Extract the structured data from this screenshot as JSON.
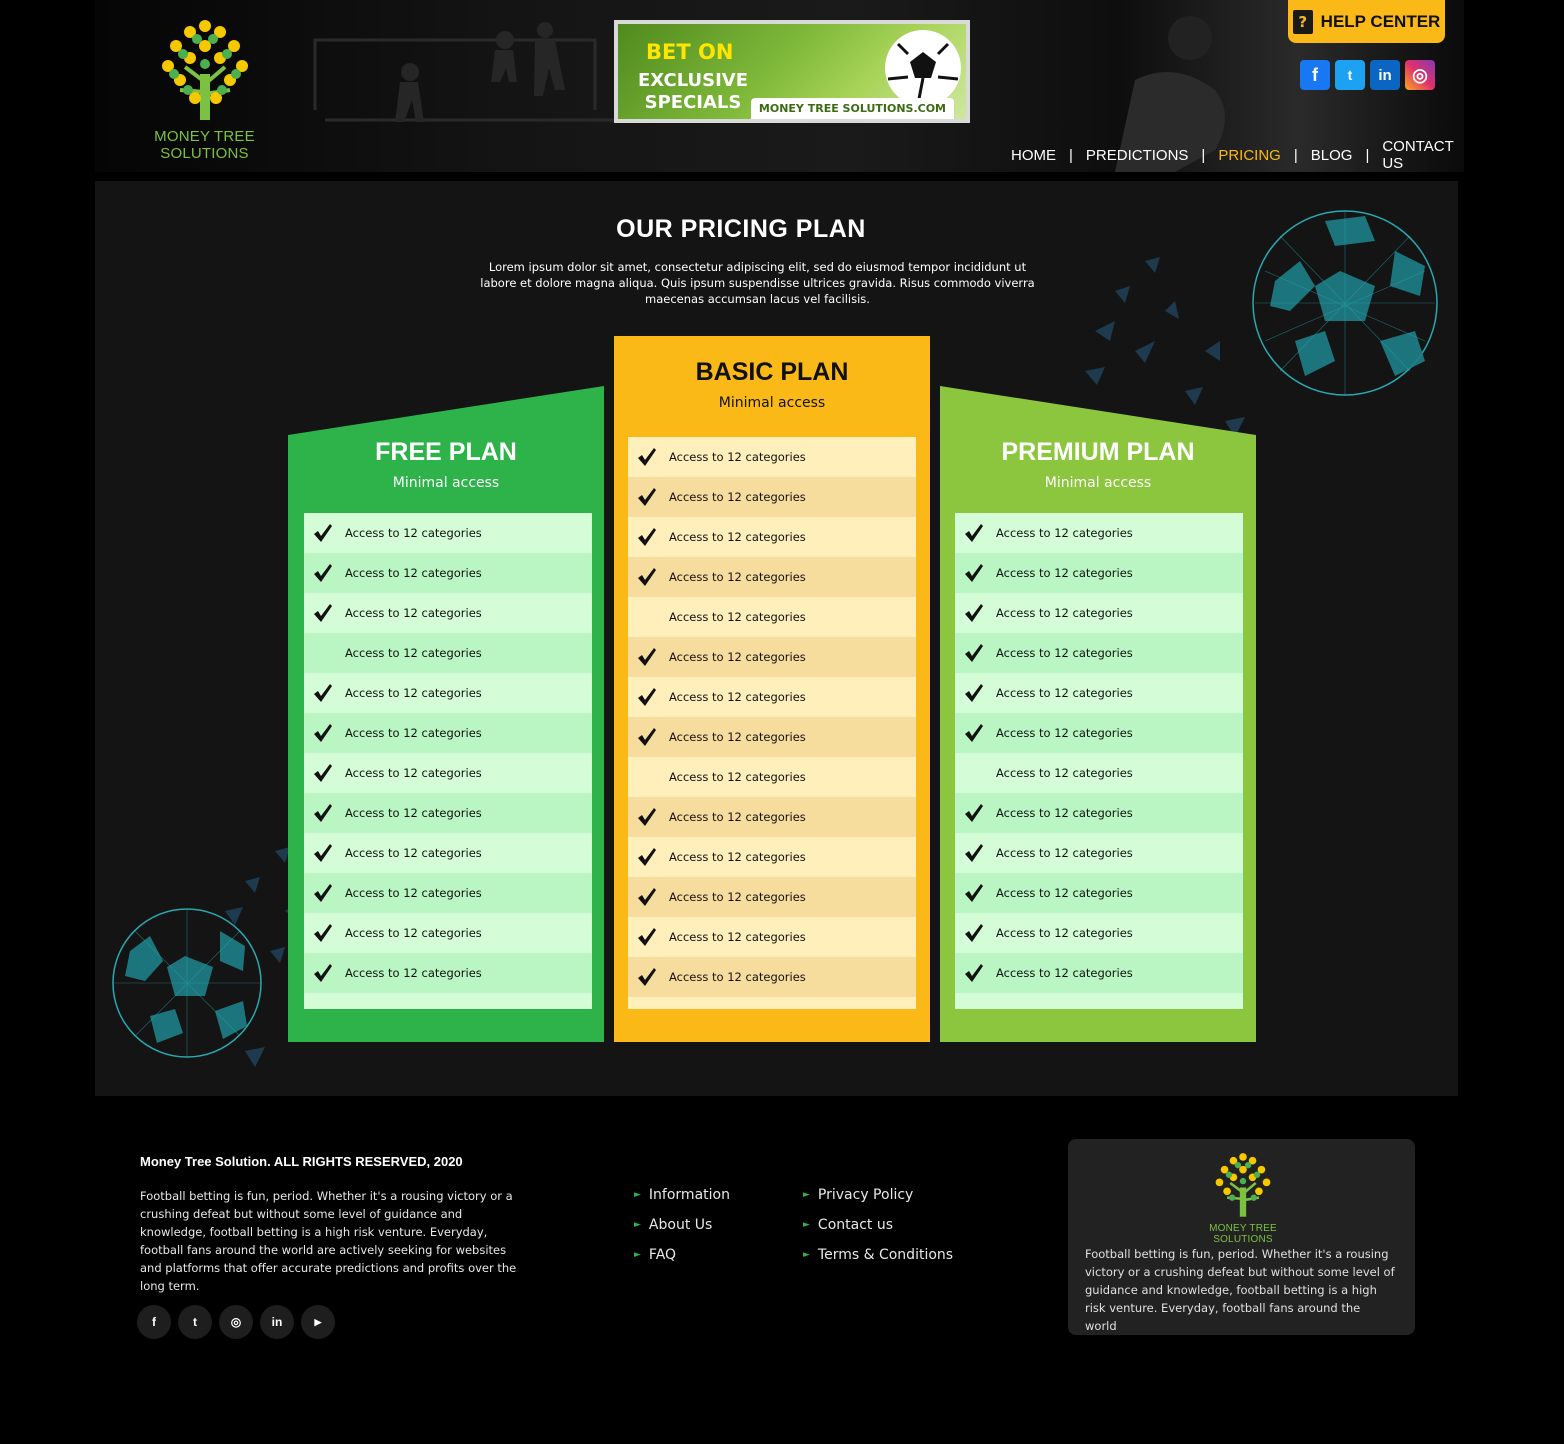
{
  "header": {
    "logo_text": "MONEY TREE SOLUTIONS",
    "banner": {
      "line1": "BET ON",
      "line2": "EXCLUSIVE",
      "line3": "SPECIALS",
      "site": "MONEY TREE SOLUTIONS.COM"
    },
    "help_center": "HELP CENTER",
    "help_icon_glyph": "?",
    "socials": [
      {
        "name": "facebook",
        "glyph": "f",
        "color": "#1877f2"
      },
      {
        "name": "twitter",
        "glyph": "t",
        "color": "#1da1f2"
      },
      {
        "name": "linkedin",
        "glyph": "in",
        "color": "#0a66c2"
      },
      {
        "name": "instagram",
        "glyph": "◎",
        "color": "#e1306c"
      }
    ],
    "nav": [
      "HOME",
      "PREDICTIONS",
      "PRICING",
      "BLOG",
      "CONTACT US"
    ],
    "nav_separator": "|",
    "nav_active": "PRICING"
  },
  "main": {
    "title": "OUR PRICING PLAN",
    "intro": "Lorem ipsum dolor sit amet, consectetur adipiscing elit, sed do eiusmod tempor incididunt ut labore et dolore magna aliqua. Quis ipsum suspendisse ultrices gravida. Risus commodo viverra maecenas accumsan lacus vel facilisis."
  },
  "plans": [
    {
      "name": "FREE PLAN",
      "subtitle": "Minimal access",
      "color": "#2db34a",
      "row_colors": [
        "#d4fdd7",
        "#baf6c4"
      ],
      "features": [
        {
          "text": "Access to 12 categories",
          "checked": true
        },
        {
          "text": "Access to 12 categories",
          "checked": true
        },
        {
          "text": "Access to 12 categories",
          "checked": true
        },
        {
          "text": "Access to 12 categories",
          "checked": false
        },
        {
          "text": "Access to 12 categories",
          "checked": true
        },
        {
          "text": "Access to 12 categories",
          "checked": true
        },
        {
          "text": "Access to 12 categories",
          "checked": true
        },
        {
          "text": "Access to 12 categories",
          "checked": true
        },
        {
          "text": "Access to 12 categories",
          "checked": true
        },
        {
          "text": "Access to 12 categories",
          "checked": true
        },
        {
          "text": "Access to 12 categories",
          "checked": true
        },
        {
          "text": "Access to 12 categories",
          "checked": true
        }
      ]
    },
    {
      "name": "BASIC PLAN",
      "subtitle": "Minimal access",
      "color": "#fbb917",
      "row_colors": [
        "#ffefbb",
        "#f6dd9d"
      ],
      "features": [
        {
          "text": "Access to 12 categories",
          "checked": true
        },
        {
          "text": "Access to 12 categories",
          "checked": true
        },
        {
          "text": "Access to 12 categories",
          "checked": true
        },
        {
          "text": "Access to 12 categories",
          "checked": true
        },
        {
          "text": "Access to 12 categories",
          "checked": false
        },
        {
          "text": "Access to 12 categories",
          "checked": true
        },
        {
          "text": "Access to 12 categories",
          "checked": true
        },
        {
          "text": "Access to 12 categories",
          "checked": true
        },
        {
          "text": "Access to 12 categories",
          "checked": false
        },
        {
          "text": "Access to 12 categories",
          "checked": true
        },
        {
          "text": "Access to 12 categories",
          "checked": true
        },
        {
          "text": "Access to 12 categories",
          "checked": true
        },
        {
          "text": "Access to 12 categories",
          "checked": true
        },
        {
          "text": "Access to 12 categories",
          "checked": true
        }
      ]
    },
    {
      "name": "PREMIUM PLAN",
      "subtitle": "Minimal access",
      "color": "#8cc63f",
      "row_colors": [
        "#d4fdd7",
        "#baf6c4"
      ],
      "features": [
        {
          "text": "Access to 12 categories",
          "checked": true
        },
        {
          "text": "Access to 12 categories",
          "checked": true
        },
        {
          "text": "Access to 12 categories",
          "checked": true
        },
        {
          "text": "Access to 12 categories",
          "checked": true
        },
        {
          "text": "Access to 12 categories",
          "checked": true
        },
        {
          "text": "Access to 12 categories",
          "checked": true
        },
        {
          "text": "Access to 12 categories",
          "checked": false
        },
        {
          "text": "Access to 12 categories",
          "checked": true
        },
        {
          "text": "Access to 12 categories",
          "checked": true
        },
        {
          "text": "Access to 12 categories",
          "checked": true
        },
        {
          "text": "Access to 12 categories",
          "checked": true
        },
        {
          "text": "Access to 12 categories",
          "checked": true
        }
      ]
    }
  ],
  "footer": {
    "title": "Money Tree Solution. ALL RIGHTS RESERVED, 2020",
    "description": "Football betting is fun, period. Whether it's a rousing victory or a crushing defeat but without some level of guidance and knowledge, football betting is a high risk venture. Everyday, football fans around the world are actively seeking for websites and platforms that offer accurate predictions and profits over the long term.",
    "socials": [
      {
        "name": "facebook",
        "glyph": "f"
      },
      {
        "name": "twitter",
        "glyph": "t"
      },
      {
        "name": "instagram",
        "glyph": "◎"
      },
      {
        "name": "linkedin",
        "glyph": "in"
      },
      {
        "name": "youtube",
        "glyph": "▶"
      }
    ],
    "links_col1": [
      "Information",
      "About Us",
      "FAQ"
    ],
    "links_col2": [
      "Privacy Policy",
      "Contact us",
      "Terms & Conditions"
    ],
    "link_bullet": "►",
    "card_logo_text": "MONEY TREE SOLUTIONS",
    "card_text": "Football betting is fun, period. Whether it's a rousing victory or a crushing defeat but without some level of guidance and knowledge, football betting is a high risk venture. Everyday, football fans around the world"
  }
}
